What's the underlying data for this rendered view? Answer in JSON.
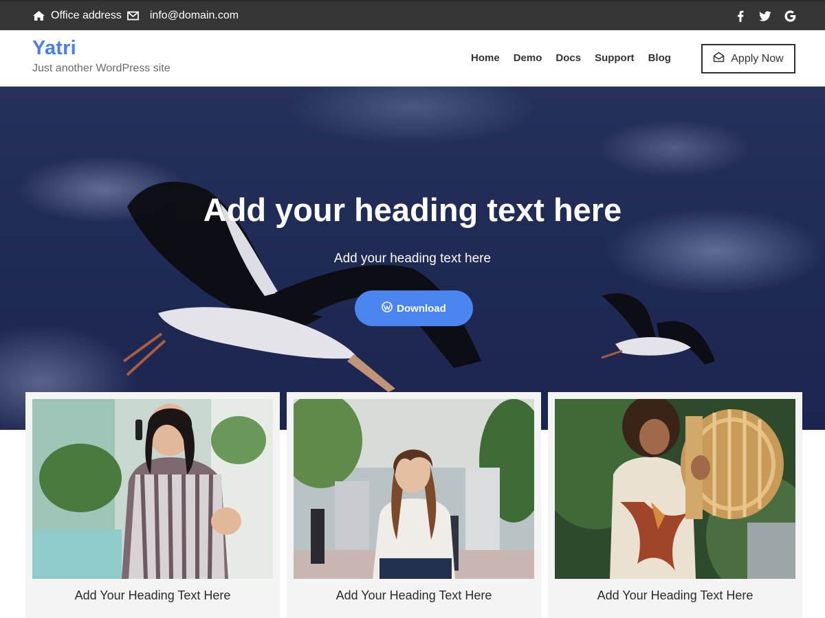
{
  "topbar": {
    "address": "Office address",
    "email": "info@domain.com",
    "social": [
      "facebook-icon",
      "twitter-icon",
      "google-icon"
    ]
  },
  "header": {
    "site_title": "Yatri",
    "tagline": "Just another WordPress site",
    "nav": [
      "Home",
      "Demo",
      "Docs",
      "Support",
      "Blog"
    ],
    "apply_label": "Apply Now"
  },
  "hero": {
    "title": "Add your heading text here",
    "subtitle": "Add your heading text here",
    "button_label": "Download"
  },
  "cards": [
    {
      "caption": "Add Your Heading Text Here"
    },
    {
      "caption": "Add Your Heading Text Here"
    },
    {
      "caption": "Add Your Heading Text Here"
    }
  ],
  "colors": {
    "accent": "#4a86ef",
    "brand": "#4a7ee8",
    "topbar_bg": "#363636",
    "hero_bg": "#1f2a55"
  }
}
